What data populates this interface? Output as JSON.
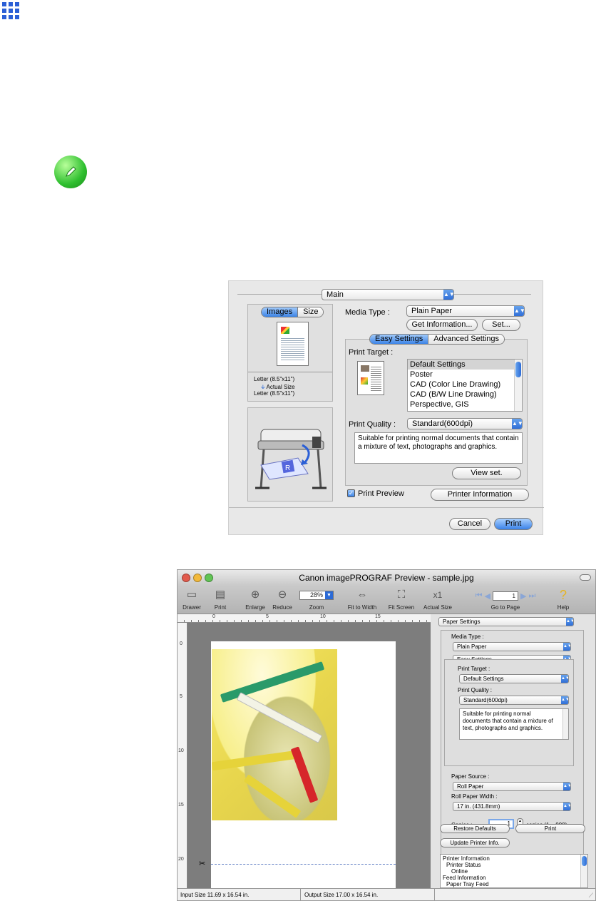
{
  "dialog": {
    "panel_select": "Main",
    "preview_tabs": [
      "Images",
      "Size"
    ],
    "size_lines": [
      "Letter (8.5\"x11\")",
      "Actual Size",
      "Letter (8.5\"x11\")"
    ],
    "media_type_label": "Media Type :",
    "media_type_value": "Plain Paper",
    "get_info_button": "Get Information...",
    "set_button": "Set...",
    "settings_tabs": [
      "Easy Settings",
      "Advanced Settings"
    ],
    "print_target_label": "Print Target :",
    "print_targets": [
      "Default Settings",
      "Poster",
      "CAD (Color Line Drawing)",
      "CAD (B/W Line Drawing)",
      "Perspective, GIS"
    ],
    "print_quality_label": "Print Quality :",
    "print_quality_value": "Standard(600dpi)",
    "description": "Suitable for printing normal documents that contain a mixture of text, photographs and graphics.",
    "view_set_button": "View set.",
    "print_preview_label": "Print Preview",
    "printer_info_button": "Printer Information",
    "cancel_button": "Cancel",
    "print_button": "Print"
  },
  "preview": {
    "title": "Canon imagePROGRAF Preview - sample.jpg",
    "toolbar": {
      "drawer": "Drawer",
      "print": "Print",
      "enlarge": "Enlarge",
      "reduce": "Reduce",
      "zoom_value": "28%",
      "zoom": "Zoom",
      "fit_width": "Fit to Width",
      "fit_screen": "Fit Screen",
      "actual_size": "Actual Size",
      "page_value": "1",
      "go_to_page": "Go to Page",
      "help": "Help"
    },
    "ruler_h": [
      "0",
      "5",
      "10",
      "15"
    ],
    "ruler_v": [
      "0",
      "5",
      "10",
      "15",
      "20"
    ],
    "sidebar": {
      "section": "Paper Settings",
      "media_type_label": "Media Type :",
      "media_type_value": "Plain Paper",
      "settings_mode": "Easy Settings",
      "print_target_label": "Print Target :",
      "print_target_value": "Default Settings",
      "print_quality_label": "Print Quality :",
      "print_quality_value": "Standard(600dpi)",
      "description": "Suitable for printing normal documents that contain a mixture of text, photographs and graphics.",
      "paper_source_label": "Paper Source :",
      "paper_source_value": "Roll Paper",
      "roll_width_label": "Roll Paper Width :",
      "roll_width_value": "17 in. (431.8mm)",
      "copies_label": "Copies :",
      "copies_value": "1",
      "copies_range": "copies (1 – 999)",
      "restore_button": "Restore Defaults",
      "print_button": "Print",
      "update_button": "Update Printer Info.",
      "info_lines": [
        "Printer Information",
        "Printer Status",
        "Online",
        "Feed Information",
        "Paper Tray Feed"
      ]
    },
    "status": {
      "input_size": "Input Size 11.69 x 16.54 in.",
      "output_size": "Output Size 17.00 x 16.54 in."
    }
  }
}
